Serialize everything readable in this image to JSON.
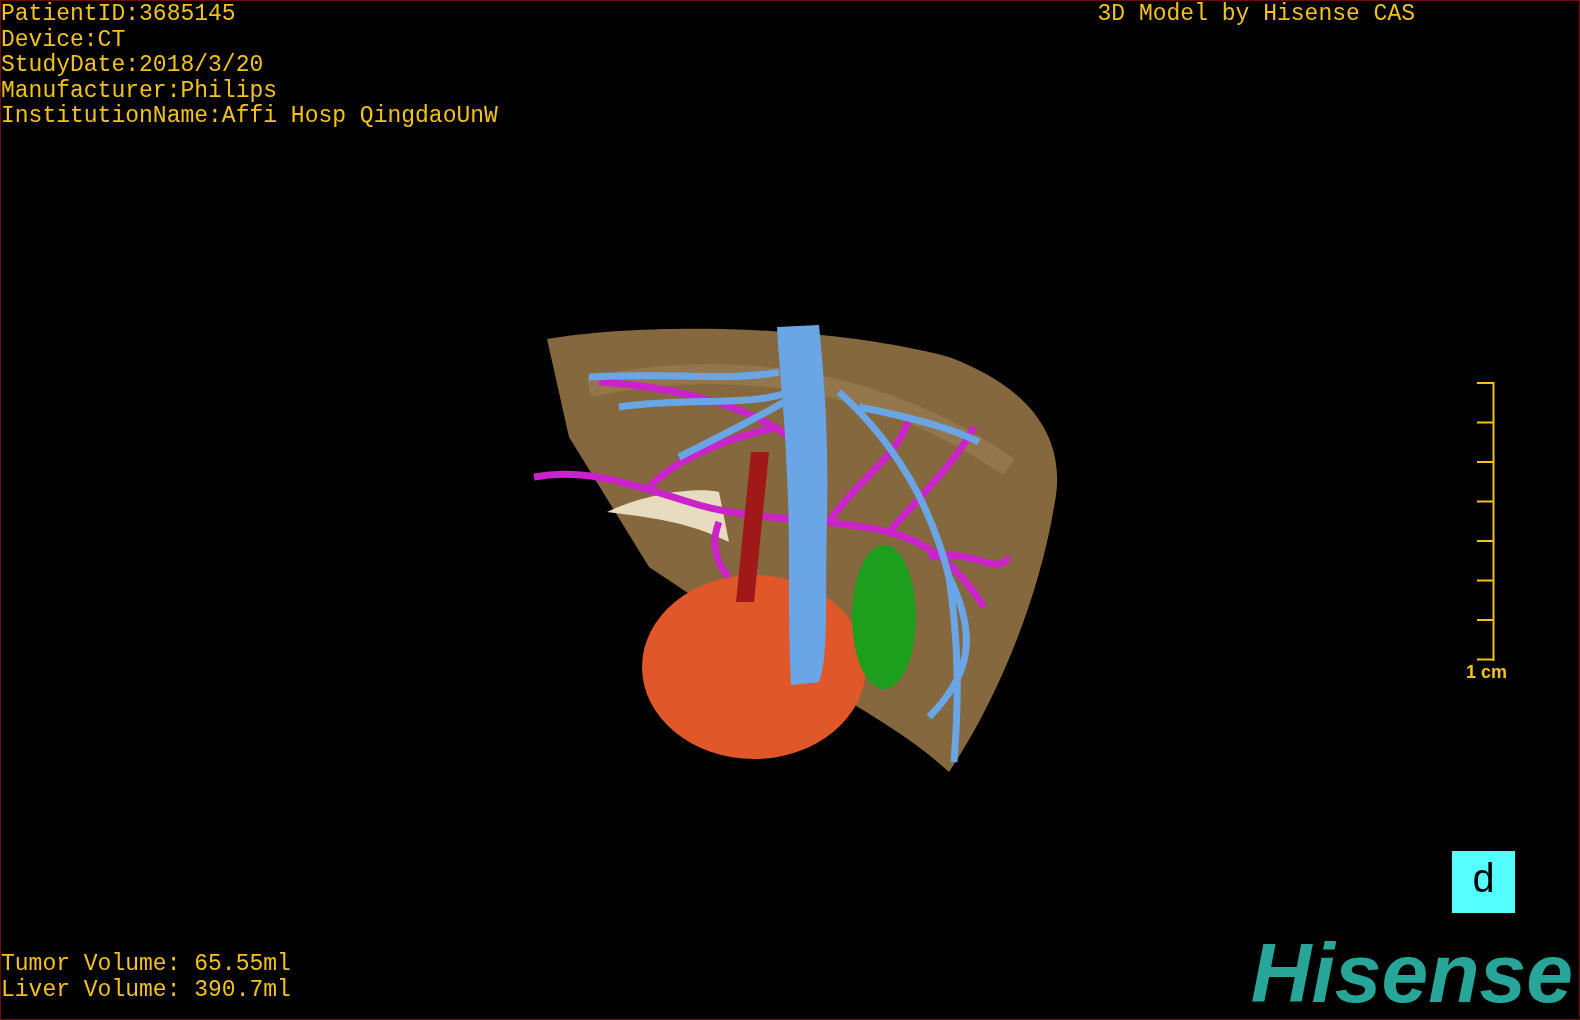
{
  "study_info": [
    "PatientID:3685145",
    "Device:CT",
    "StudyDate:2018/3/20",
    "Manufacturer:Philips",
    "InstitutionName:Affi Hosp QingdaoUnW"
  ],
  "title": "3D Model by Hisense CAS",
  "scale": {
    "label": "1 cm"
  },
  "volumes": [
    "Tumor Volume: 65.55ml",
    "Liver Volume: 390.7ml"
  ],
  "view_button": {
    "label": "d"
  },
  "logo": "Hisense"
}
